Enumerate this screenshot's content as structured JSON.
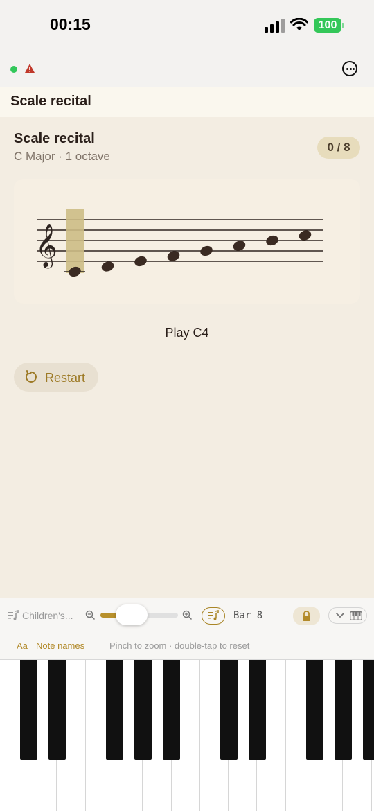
{
  "status_bar": {
    "time": "00:15",
    "battery": "100"
  },
  "header": {
    "title": "Scale recital"
  },
  "exercise": {
    "title": "Scale recital",
    "subtitle": "C Major · 1 octave",
    "score": "0 / 8",
    "prompt": "Play C4",
    "restart_label": "Restart"
  },
  "staff": {
    "clef": "treble",
    "notes": [
      "C4",
      "D4",
      "E4",
      "F4",
      "G4",
      "A4",
      "B4",
      "C5"
    ],
    "highlighted_note": "C4"
  },
  "toolbar": {
    "song_label": "Children's...",
    "bar_label": "Bar 8",
    "zoom_level": 0.4
  },
  "options": {
    "font_label": "Aa",
    "note_names_label": "Note names",
    "hint": "Pinch to zoom · double-tap to reset"
  },
  "colors": {
    "accent": "#b8902b",
    "background": "#f3ede2",
    "note": "#3a2a22",
    "highlight": "#cdbd85"
  }
}
